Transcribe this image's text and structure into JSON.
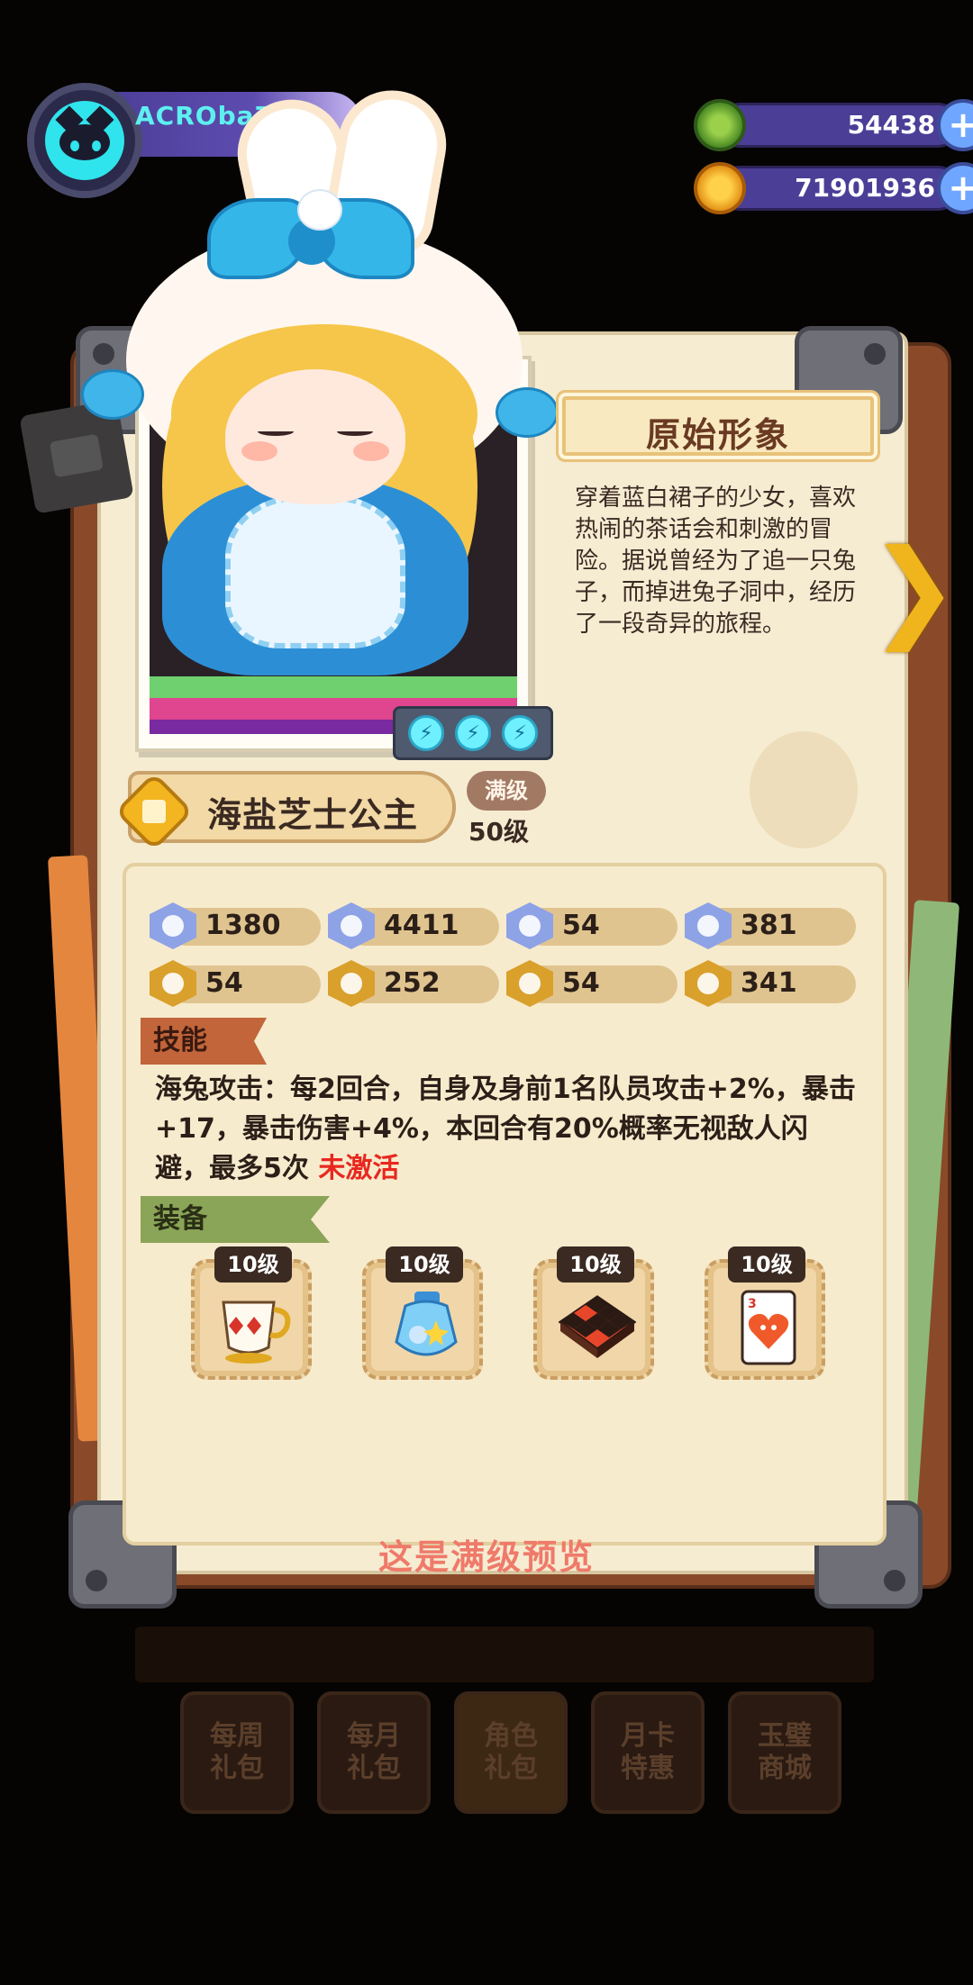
{
  "player": {
    "name": "ACROba77"
  },
  "currencies": [
    {
      "name": "gems",
      "value": "54438",
      "icon": "green-gem-icon",
      "color": "#5fa83a"
    },
    {
      "name": "coins",
      "value": "71901936",
      "icon": "gold-planet-coin-icon",
      "color": "#f2a81d"
    }
  ],
  "character": {
    "title": "原始形象",
    "description": "穿着蓝白裙子的少女，喜欢热闹的茶话会和刺激的冒险。据说曾经为了追一只兔子，而掉进兔子洞中，经历了一段奇异的旅程。",
    "name": "海盐芝士公主",
    "max_badge": "满级",
    "level": "50级",
    "energy_count": 3
  },
  "stats": [
    {
      "icon": "heart-shield-icon",
      "value": "1380",
      "style": "blue"
    },
    {
      "icon": "attack-icon",
      "value": "4411",
      "style": "blue"
    },
    {
      "icon": "defense-shield-icon",
      "value": "54",
      "style": "blue"
    },
    {
      "icon": "crit-icon",
      "value": "381",
      "style": "blue"
    },
    {
      "icon": "speed-icon",
      "value": "54",
      "style": "gold"
    },
    {
      "icon": "dodge-icon",
      "value": "252",
      "style": "gold"
    },
    {
      "icon": "strength-icon",
      "value": "54",
      "style": "gold"
    },
    {
      "icon": "resist-icon",
      "value": "341",
      "style": "gold"
    }
  ],
  "skill": {
    "label": "技能",
    "text": "海兔攻击：每2回合，自身及身前1名队员攻击+2%，暴击+17，暴击伤害+4%，本回合有20%概率无视敌人闪避，最多5次",
    "status": "未激活"
  },
  "equipment": {
    "label": "装备",
    "items": [
      {
        "icon": "teacup-icon",
        "level": "10级"
      },
      {
        "icon": "cookie-jar-icon",
        "level": "10级"
      },
      {
        "icon": "checkerboard-icon",
        "level": "10级"
      },
      {
        "icon": "heart-card-icon",
        "level": "10级"
      }
    ]
  },
  "preview_note": "这是满级预览",
  "shop_buttons": [
    {
      "label": "每周礼包",
      "active": false
    },
    {
      "label": "每月礼包",
      "active": false
    },
    {
      "label": "角色礼包",
      "active": true
    },
    {
      "label": "月卡特惠",
      "active": false
    },
    {
      "label": "玉璧商城",
      "active": false
    }
  ],
  "colors": {
    "accent_red": "#e8281f",
    "page": "#f6ecd2",
    "skill_tag": "#c2653a",
    "equip_tag": "#8aa458"
  }
}
